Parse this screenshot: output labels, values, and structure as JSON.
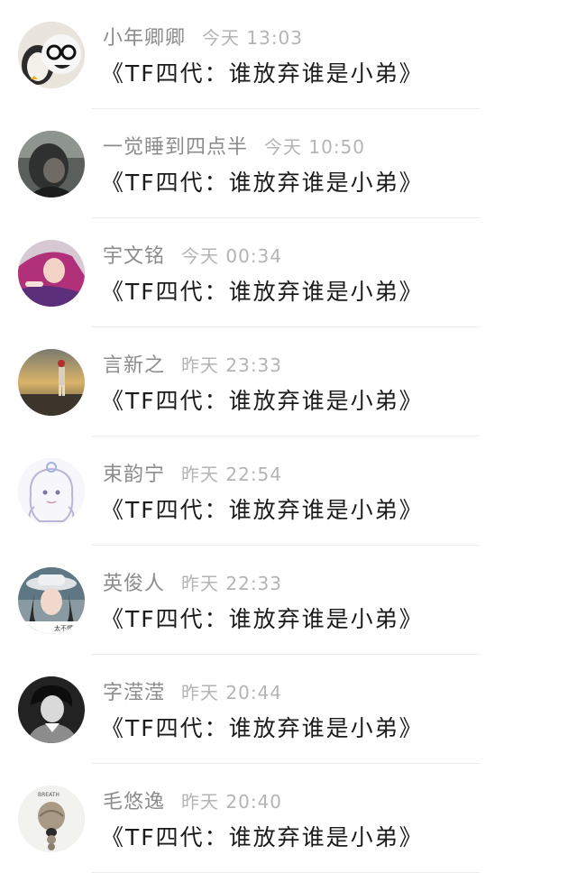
{
  "comments": [
    {
      "name": "小年卿卿",
      "time": "今天 13:03",
      "text": "《TF四代：谁放弃谁是小弟》",
      "avatar_icon": "penguin-avatar-icon"
    },
    {
      "name": "一觉睡到四点半",
      "time": "今天 10:50",
      "text": "《TF四代：谁放弃谁是小弟》",
      "avatar_icon": "dark-portrait-avatar-icon"
    },
    {
      "name": "宇文铭",
      "time": "今天 00:34",
      "text": "《TF四代：谁放弃谁是小弟》",
      "avatar_icon": "pink-hair-girl-avatar-icon"
    },
    {
      "name": "言新之",
      "time": "昨天 23:33",
      "text": "《TF四代：谁放弃谁是小弟》",
      "avatar_icon": "sunset-figure-avatar-icon"
    },
    {
      "name": "束韵宁",
      "time": "昨天 22:54",
      "text": "《TF四代：谁放弃谁是小弟》",
      "avatar_icon": "sketch-girl-avatar-icon"
    },
    {
      "name": "英俊人",
      "time": "昨天 22:33",
      "text": "《TF四代：谁放弃谁是小弟》",
      "avatar_icon": "hat-girl-avatar-icon"
    },
    {
      "name": "字滢滢",
      "time": "昨天 20:44",
      "text": "《TF四代：谁放弃谁是小弟》",
      "avatar_icon": "bw-boy-avatar-icon"
    },
    {
      "name": "毛悠逸",
      "time": "昨天 20:40",
      "text": "《TF四代：谁放弃谁是小弟》",
      "avatar_icon": "breath-braid-avatar-icon"
    }
  ],
  "avatar_text": {
    "hat_caption": "太不懂",
    "breath_caption": "BREATH"
  }
}
